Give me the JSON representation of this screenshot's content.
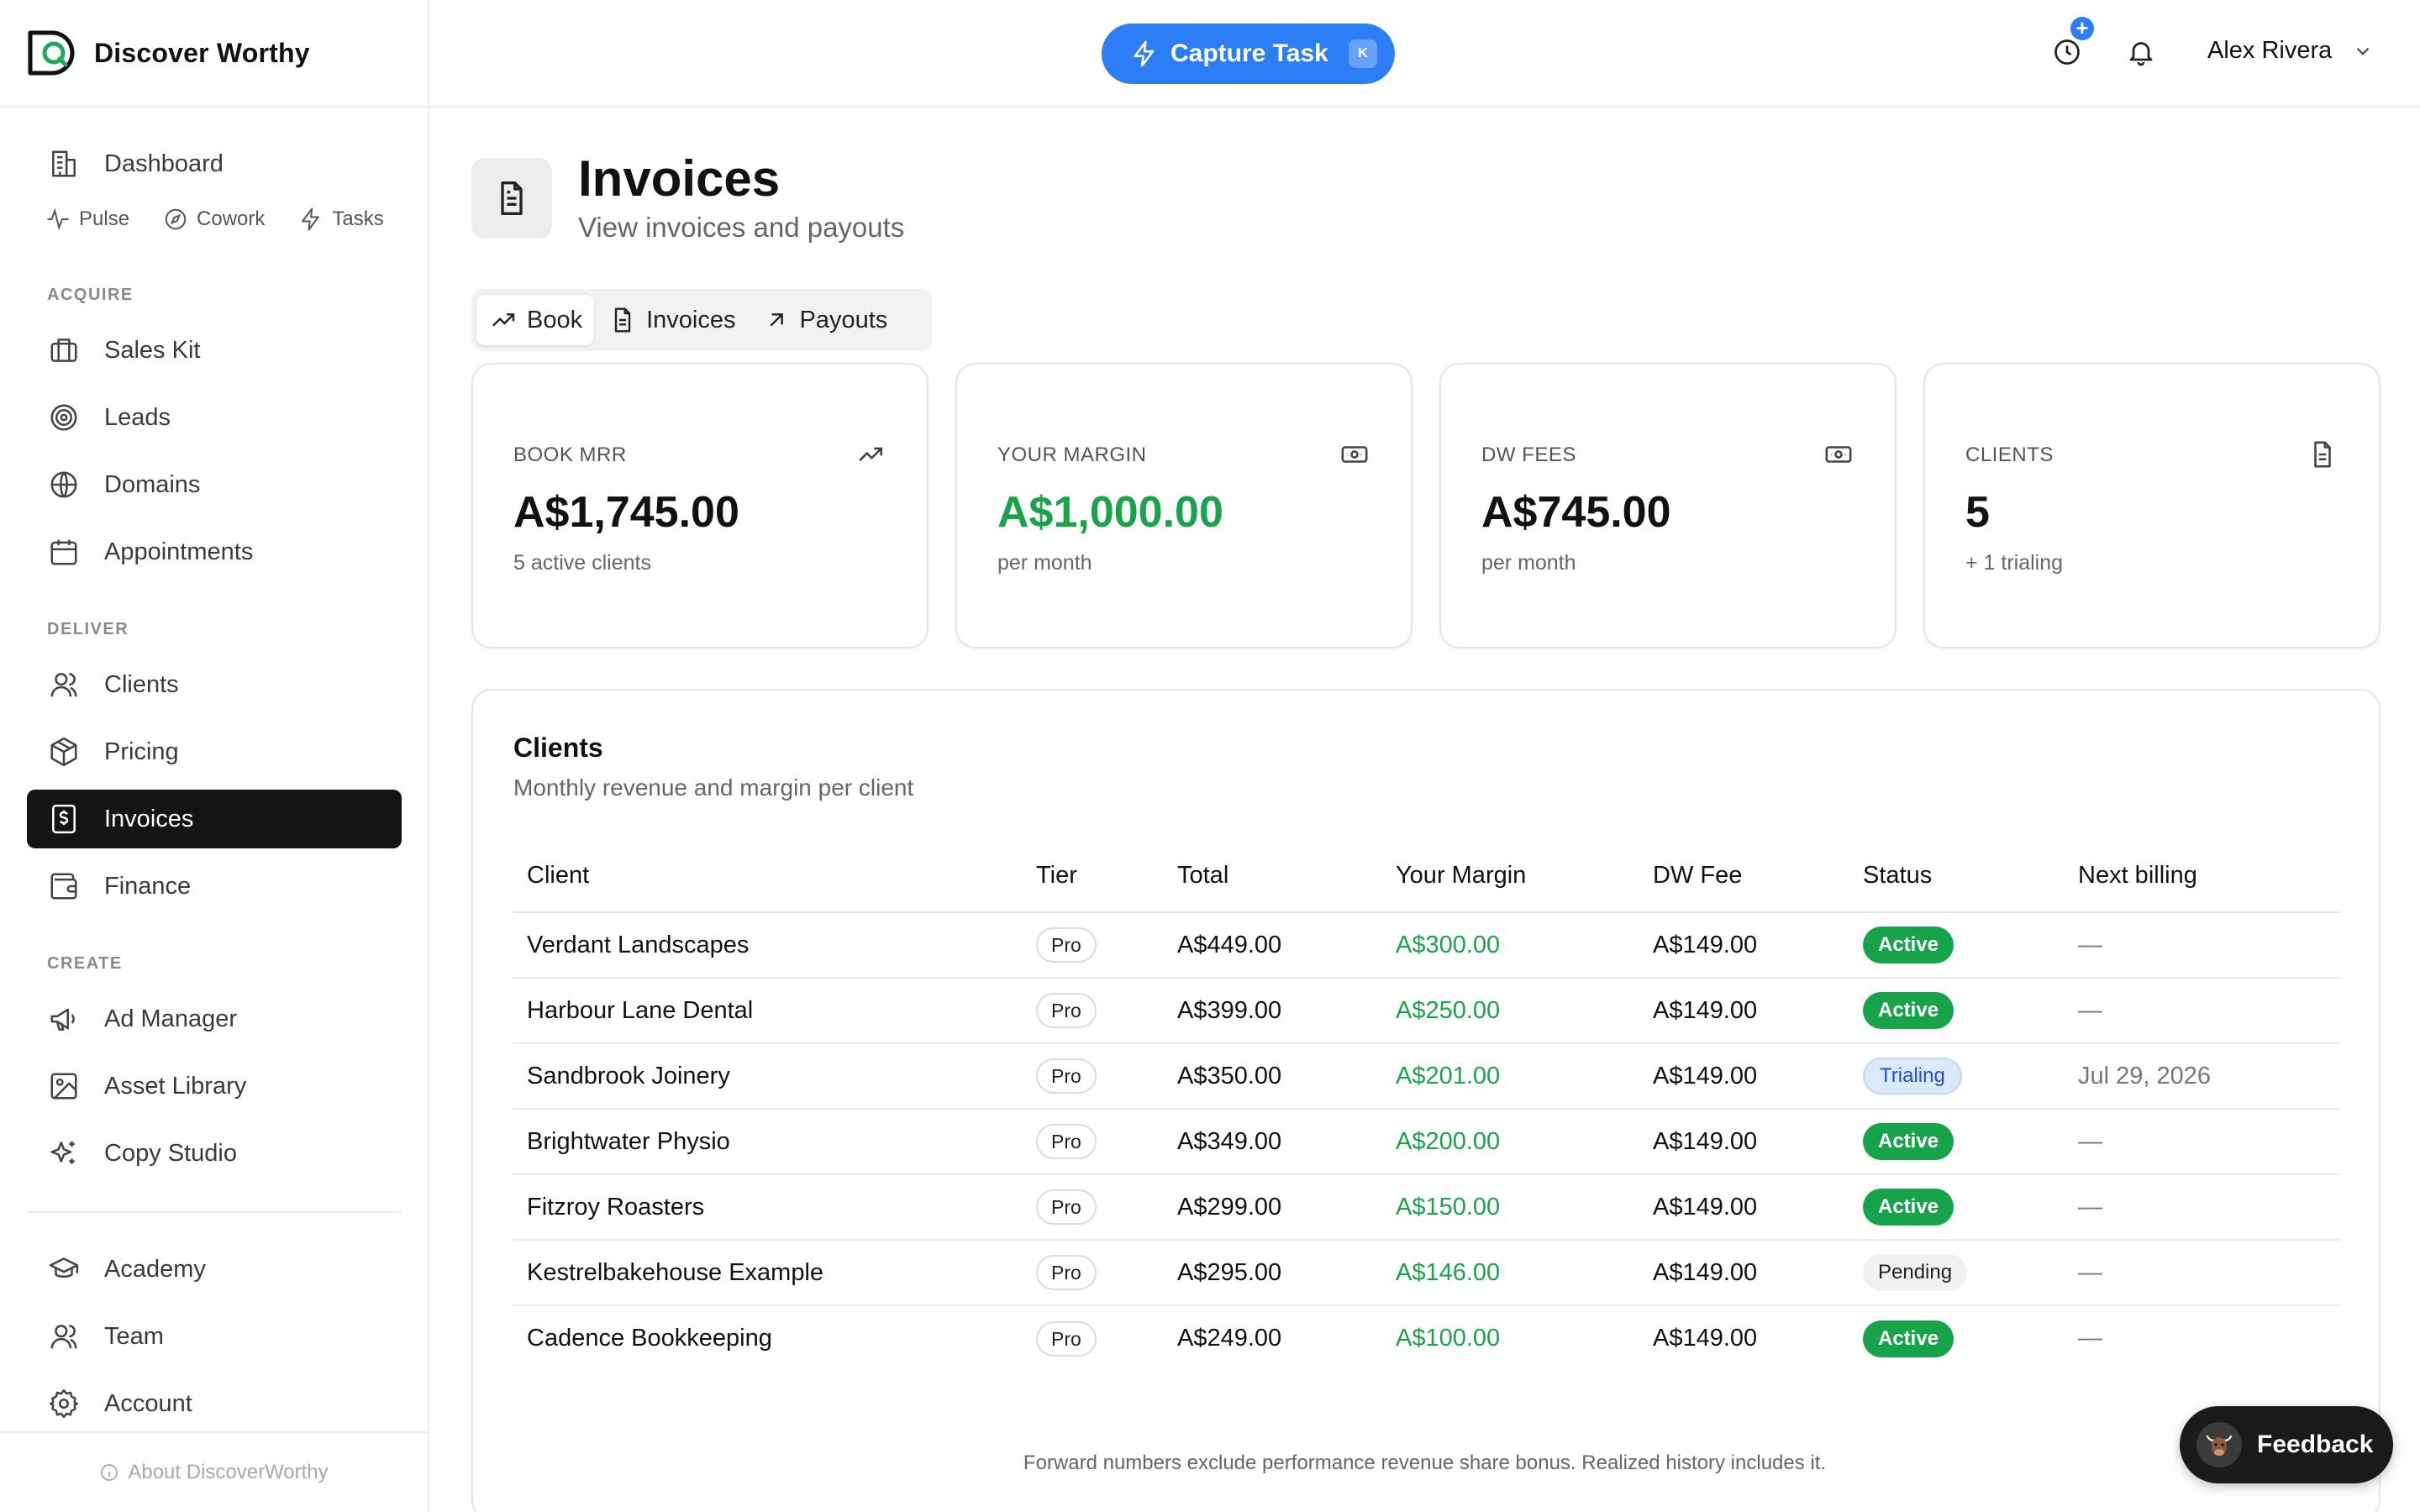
{
  "brand": {
    "name": "Discover Worthy"
  },
  "sidebar": {
    "dashboard": "Dashboard",
    "quick_links": [
      {
        "label": "Pulse",
        "icon": "pulse-icon"
      },
      {
        "label": "Cowork",
        "icon": "compass-icon"
      },
      {
        "label": "Tasks",
        "icon": "bolt-icon"
      }
    ],
    "sections": {
      "acquire": "ACQUIRE",
      "deliver": "DELIVER",
      "create": "CREATE"
    },
    "items": {
      "sales_kit": "Sales Kit",
      "leads": "Leads",
      "domains": "Domains",
      "appointments": "Appointments",
      "clients": "Clients",
      "pricing": "Pricing",
      "invoices": "Invoices",
      "finance": "Finance",
      "ad_manager": "Ad Manager",
      "asset_library": "Asset Library",
      "copy_studio": "Copy Studio",
      "academy": "Academy",
      "team": "Team",
      "account": "Account"
    },
    "active_item": "Invoices",
    "about": "About DiscoverWorthy"
  },
  "topbar": {
    "capture_label": "Capture Task",
    "capture_shortcut": "K",
    "user_name": "Alex Rivera"
  },
  "page": {
    "title": "Invoices",
    "subtitle": "View invoices and payouts"
  },
  "tabs": [
    {
      "label": "Book",
      "active": true
    },
    {
      "label": "Invoices",
      "active": false
    },
    {
      "label": "Payouts",
      "active": false
    }
  ],
  "stats": [
    {
      "label": "BOOK MRR",
      "value": "A$1,745.00",
      "sub": "5 active clients",
      "icon": "trending-up-icon"
    },
    {
      "label": "YOUR MARGIN",
      "value": "A$1,000.00",
      "sub": "per month",
      "icon": "cash-icon"
    },
    {
      "label": "DW FEES",
      "value": "A$745.00",
      "sub": "per month",
      "icon": "cash-icon"
    },
    {
      "label": "CLIENTS",
      "value": "5",
      "sub": "+ 1 trialing",
      "icon": "document-icon"
    }
  ],
  "clients_table": {
    "title": "Clients",
    "subtitle": "Monthly revenue and margin per client",
    "columns": [
      "Client",
      "Tier",
      "Total",
      "Your Margin",
      "DW Fee",
      "Status",
      "Next billing"
    ],
    "rows": [
      {
        "client": "Verdant Landscapes",
        "tier": "Pro",
        "total": "A$449.00",
        "margin": "A$300.00",
        "fee": "A$149.00",
        "status": "Active",
        "next": "—"
      },
      {
        "client": "Harbour Lane Dental",
        "tier": "Pro",
        "total": "A$399.00",
        "margin": "A$250.00",
        "fee": "A$149.00",
        "status": "Active",
        "next": "—"
      },
      {
        "client": "Sandbrook Joinery",
        "tier": "Pro",
        "total": "A$350.00",
        "margin": "A$201.00",
        "fee": "A$149.00",
        "status": "Trialing",
        "next": "Jul 29, 2026"
      },
      {
        "client": "Brightwater Physio",
        "tier": "Pro",
        "total": "A$349.00",
        "margin": "A$200.00",
        "fee": "A$149.00",
        "status": "Active",
        "next": "—"
      },
      {
        "client": "Fitzroy Roasters",
        "tier": "Pro",
        "total": "A$299.00",
        "margin": "A$150.00",
        "fee": "A$149.00",
        "status": "Active",
        "next": "—"
      },
      {
        "client": "Kestrelbakehouse Example",
        "tier": "Pro",
        "total": "A$295.00",
        "margin": "A$146.00",
        "fee": "A$149.00",
        "status": "Pending",
        "next": "—"
      },
      {
        "client": "Cadence Bookkeeping",
        "tier": "Pro",
        "total": "A$249.00",
        "margin": "A$100.00",
        "fee": "A$149.00",
        "status": "Active",
        "next": "—"
      }
    ]
  },
  "footer_note": "Forward numbers exclude performance revenue share bonus. Realized history includes it.",
  "feedback_label": "Feedback",
  "colors": {
    "accent_blue": "#2d7df6",
    "margin_green": "#19a34a",
    "status_active": "#16a34a",
    "status_trialing_bg": "#dbeafe",
    "nav_active_bg": "#141414"
  }
}
